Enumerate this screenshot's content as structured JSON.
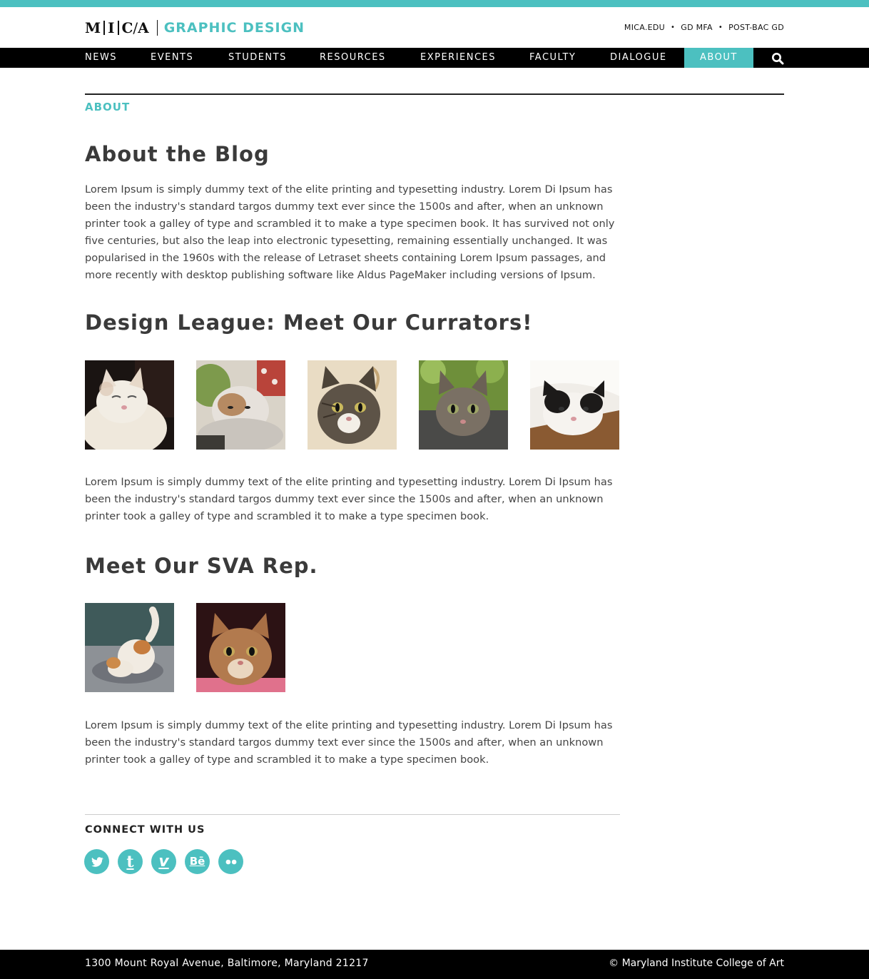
{
  "header": {
    "logo_letters": [
      "M",
      "I",
      "C",
      "A"
    ],
    "site_title": "GRAPHIC DESIGN",
    "util_links": [
      "MICA.EDU",
      "GD MFA",
      "POST-BAC GD"
    ]
  },
  "nav": {
    "items": [
      "NEWS",
      "EVENTS",
      "STUDENTS",
      "RESOURCES",
      "EXPERIENCES",
      "FACULTY",
      "DIALOGUE",
      "ABOUT"
    ],
    "active": "ABOUT",
    "search_icon": "search-icon"
  },
  "page": {
    "breadcrumb": "ABOUT",
    "sections": [
      {
        "heading": "About the Blog",
        "text": "Lorem Ipsum is simply dummy text of the elite printing and typesetting industry. Lorem Di Ipsum has been the industry's standard targos dummy text ever since the 1500s and after, when an unknown printer took a galley of type and scrambled it to make a type specimen book. It has survived not only five centuries, but also the leap into electronic typesetting, remaining essentially unchanged. It was popularised in the 1960s with the release of Letraset sheets containing Lorem Ipsum passages, and more recently with desktop publishing software like Aldus PageMaker including versions of Ipsum."
      },
      {
        "heading": "Design League: Meet Our Currators!",
        "text": "Lorem Ipsum is simply dummy text of the elite printing and typesetting industry. Lorem Di Ipsum has been the industry's standard targos dummy text ever since the 1500s and after, when an unknown printer took a galley of type and scrambled it to make a type specimen book."
      },
      {
        "heading": "Meet Our SVA Rep.",
        "text": "Lorem Ipsum is simply dummy text of the elite printing and typesetting industry. Lorem Di Ipsum has been the industry's standard targos dummy text ever since the 1500s and after, when an unknown printer took a galley of type and scrambled it to make a type specimen book."
      }
    ]
  },
  "connect": {
    "title": "CONNECT WITH US",
    "icons": [
      "twitter-icon",
      "tumblr-icon",
      "vimeo-icon",
      "behance-icon",
      "flickr-icon"
    ]
  },
  "footer": {
    "address": "1300 Mount Royal Avenue, Baltimore, Maryland 21217",
    "copyright": "© Maryland Institute College of Art"
  },
  "colors": {
    "accent": "#4cc0c0",
    "nav_bg": "#000000",
    "heading": "#3a3a3a"
  }
}
